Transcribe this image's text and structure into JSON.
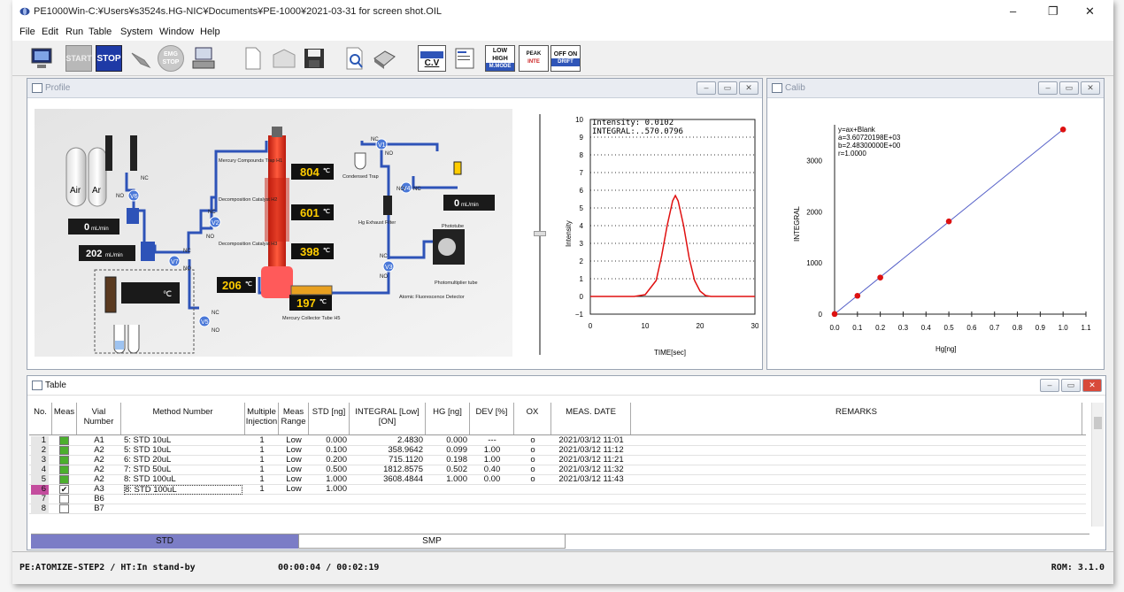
{
  "window": {
    "title": "PE1000Win-C:¥Users¥s3524s.HG-NIC¥Documents¥PE-1000¥2021-03-31 for screen shot.OIL",
    "minimize": "–",
    "restore": "❐",
    "close": "✕"
  },
  "menu": [
    "File",
    "Edit",
    "Run",
    "Table",
    "System",
    "Window",
    "Help"
  ],
  "toolbar": {
    "start": "START",
    "stop": "STOP",
    "emg_stop": "EMG STOP",
    "cv": "C.V",
    "low_high": "LOW HIGH",
    "m_mode": "M.MODE",
    "peak": "PEAK",
    "inte": "INTE",
    "off_on": "OFF ON",
    "drift": "DRIFT"
  },
  "profile": {
    "title": "Profile",
    "labels": {
      "air": "Air",
      "ar": "Ar",
      "nc": "NC",
      "no": "NO",
      "v1": "V1",
      "v2": "V2",
      "v3": "V3",
      "v4": "V4",
      "v5": "V5",
      "v6": "V6",
      "v7": "V7",
      "flow1_val": "0",
      "flow1_unit": "mL/min",
      "flow2_val": "202",
      "flow2_unit": "mL/min",
      "flow3_val": "0",
      "flow3_unit": "mL/min",
      "heater_c": "℃",
      "h1_label": "Mercury Compounds Trap H1",
      "h2_label": "Decomposition Catalyst H2",
      "h3_label": "Decomposition Catalyst H3",
      "h1_temp": "804",
      "h2_temp": "601",
      "h3_temp": "398",
      "t4_temp": "206",
      "h5_temp": "197",
      "deg": "℃",
      "condensed_trap": "Condensed Trap",
      "hg_filter": "Hg Exhaust Filter",
      "phototube": "Phototube",
      "pmt": "Photomultiplier tube",
      "afd": "Atomic Fluorescence Detector",
      "h5_label": "Mercury Collector Tube H5"
    },
    "peak": {
      "intensity_label": "Intensity:",
      "intensity_val": "0.0102",
      "integral_label": "INTEGRAL:",
      "integral_val": "570.0796",
      "xlabel": "TIME[sec]",
      "ylabel": "Intensity",
      "yticks": [
        "10",
        "9",
        "8",
        "7",
        "6",
        "5",
        "4",
        "3",
        "2",
        "1",
        "0",
        "−1"
      ],
      "xticks": [
        "0",
        "10",
        "20",
        "30"
      ]
    }
  },
  "calib": {
    "title": "Calib",
    "eq": "y=ax+Blank",
    "a": "a=3.60720198E+03",
    "b": "b=2.48300000E+00",
    "r": "r=1.0000",
    "xlabel": "Hg[ng]",
    "ylabel": "INTEGRAL",
    "yticks": [
      "3000",
      "2000",
      "1000",
      "0"
    ],
    "xticks": [
      "0.0",
      "0.1",
      "0.2",
      "0.3",
      "0.4",
      "0.5",
      "0.6",
      "0.7",
      "0.8",
      "0.9",
      "1.0",
      "1.1"
    ]
  },
  "chart_data": [
    {
      "type": "line",
      "title": "",
      "xlabel": "TIME[sec]",
      "ylabel": "Intensity",
      "xlim": [
        0,
        30
      ],
      "ylim": [
        -1,
        10
      ],
      "series": [
        {
          "x": [
            0,
            8,
            10,
            12,
            13,
            14,
            15,
            15.5,
            16,
            17,
            18,
            19,
            20,
            21,
            22,
            24,
            30
          ],
          "y": [
            0,
            0,
            0.1,
            0.9,
            2.3,
            4.0,
            5.4,
            5.7,
            5.4,
            4.0,
            2.2,
            0.9,
            0.3,
            0.05,
            0,
            0,
            0
          ]
        }
      ]
    },
    {
      "type": "scatter",
      "title": "",
      "xlabel": "Hg[ng]",
      "ylabel": "INTEGRAL",
      "xlim": [
        0,
        1.1
      ],
      "ylim": [
        0,
        3700
      ],
      "series": [
        {
          "x": [
            0.0,
            0.1,
            0.2,
            0.5,
            1.0
          ],
          "y": [
            2.483,
            358.9642,
            715.112,
            1812.8575,
            3608.4844
          ]
        }
      ]
    }
  ],
  "table": {
    "title": "Table",
    "headers": [
      "No.",
      "Meas",
      "Vial Number",
      "Method Number",
      "Multiple Injection",
      "Meas Range",
      "STD [ng]",
      "INTEGRAL [Low][ON]",
      "HG [ng]",
      "DEV [%]",
      "OX",
      "MEAS. DATE",
      "REMARKS"
    ],
    "rows": [
      [
        "1",
        "",
        "A1",
        "5: STD 10uL",
        "1",
        "Low",
        "0.000",
        "2.4830",
        "0.000",
        "---",
        "o",
        "2021/03/12 11:01"
      ],
      [
        "2",
        "",
        "A2",
        "5: STD 10uL",
        "1",
        "Low",
        "0.100",
        "358.9642",
        "0.099",
        "1.00",
        "o",
        "2021/03/12 11:12"
      ],
      [
        "3",
        "",
        "A2",
        "6: STD 20uL",
        "1",
        "Low",
        "0.200",
        "715.1120",
        "0.198",
        "1.00",
        "o",
        "2021/03/12 11:21"
      ],
      [
        "4",
        "",
        "A2",
        "7: STD 50uL",
        "1",
        "Low",
        "0.500",
        "1812.8575",
        "0.502",
        "0.40",
        "o",
        "2021/03/12 11:32"
      ],
      [
        "5",
        "",
        "A2",
        "8: STD 100uL",
        "1",
        "Low",
        "1.000",
        "3608.4844",
        "1.000",
        "0.00",
        "o",
        "2021/03/12 11:43"
      ],
      [
        "6",
        "✔",
        "A3",
        "8: STD 100uL",
        "1",
        "Low",
        "1.000",
        "",
        "",
        "",
        "",
        ""
      ],
      [
        "7",
        "",
        "B6",
        "",
        "",
        "",
        "",
        "",
        "",
        "",
        "",
        ""
      ],
      [
        "8",
        "",
        "B7",
        "",
        "",
        "",
        "",
        "",
        "",
        "",
        "",
        ""
      ]
    ],
    "tabs": [
      "STD",
      "SMP"
    ]
  },
  "status": {
    "left": "PE:ATOMIZE-STEP2 / HT:In stand-by",
    "time": "00:00:04 / 00:02:19",
    "rom": "ROM: 3.1.0"
  },
  "colors": {
    "accent": "#7b7dc6",
    "flow_blue": "#2e53b8",
    "heater_red": "#e8351f",
    "meas_green": "#4caf2e",
    "row6_pink": "#c44d9e",
    "peak_red": "#e01010",
    "calib_point": "#dd1111"
  }
}
